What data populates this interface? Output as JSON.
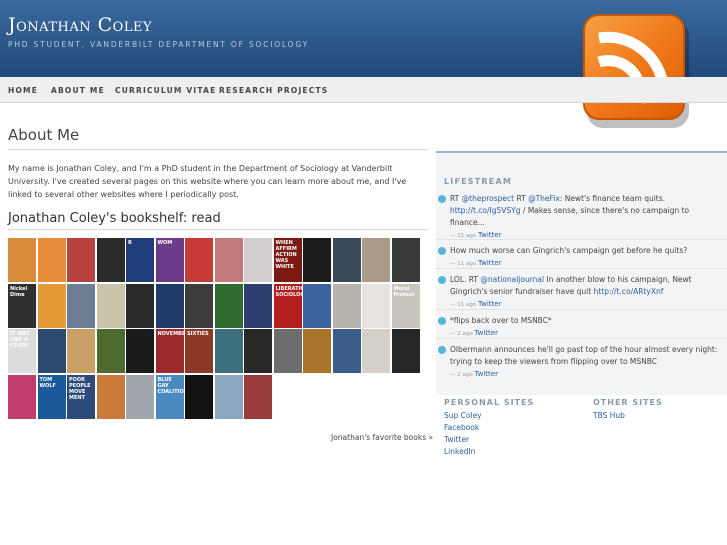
{
  "site": {
    "title": "Jonathan Coley",
    "tagline": "PhD student, Vanderbilt Department of Sociology"
  },
  "nav": [
    "Home",
    "About Me",
    "Curriculum Vitae",
    "Research Projects"
  ],
  "rss": {
    "icon": "rss-feed-icon",
    "color": "#f07a1a"
  },
  "about": {
    "heading": "About Me",
    "intro": "My name is Jonathan Coley, and I'm a PhD student in the Department of Sociology at Vanderbilt University. I've created several pages on this website where you can learn more about me, and I've linked to several other websites where I periodically post."
  },
  "bookshelf": {
    "heading": "Jonathan Coley's bookshelf: read",
    "favorite_link": "Jonathan's favorite books »",
    "books": [
      {
        "text": "",
        "color": "#d98a3a"
      },
      {
        "text": "",
        "color": "#e58b3a"
      },
      {
        "text": "",
        "color": "#b8423f"
      },
      {
        "text": "",
        "color": "#2b2b2b"
      },
      {
        "text": "R",
        "color": "#1f3d7a"
      },
      {
        "text": "WOM",
        "color": "#6b3a8a"
      },
      {
        "text": "",
        "color": "#c93b3b"
      },
      {
        "text": "",
        "color": "#c27b7a"
      },
      {
        "text": "",
        "color": "#d2ced0"
      },
      {
        "text": "WHEN AFFIRM ACTION WAS WHITE",
        "color": "#7a1a12"
      },
      {
        "text": "",
        "color": "#1d1d1d"
      },
      {
        "text": "",
        "color": "#3a4a5a"
      },
      {
        "text": "",
        "color": "#a99a8a"
      },
      {
        "text": "",
        "color": "#3a3a3a"
      },
      {
        "text": "Nickel Dime",
        "color": "#2f2f2f"
      },
      {
        "text": "",
        "color": "#e59a38"
      },
      {
        "text": "",
        "color": "#6b7e96"
      },
      {
        "text": "",
        "color": "#c9c3a8"
      },
      {
        "text": "",
        "color": "#2a2a2a"
      },
      {
        "text": "",
        "color": "#1e3b6a"
      },
      {
        "text": "",
        "color": "#3b3b3b"
      },
      {
        "text": "",
        "color": "#2f6a2f"
      },
      {
        "text": "",
        "color": "#2c3e70"
      },
      {
        "text": "LIBERATION SOCIOLOGY",
        "color": "#b21e1e"
      },
      {
        "text": "",
        "color": "#3c63a0"
      },
      {
        "text": "",
        "color": "#b8b3ad"
      },
      {
        "text": "",
        "color": "#e7e3de"
      },
      {
        "text": "Moral Protest",
        "color": "#c9c5bd"
      },
      {
        "text": "IT WAS LIKE A FEVER",
        "color": "#dcdcdc"
      },
      {
        "text": "",
        "color": "#2c4a6f"
      },
      {
        "text": "",
        "color": "#caa066"
      },
      {
        "text": "",
        "color": "#4d6b2c"
      },
      {
        "text": "",
        "color": "#1a1a1a"
      },
      {
        "text": "NOVEMBE",
        "color": "#9c2a2a"
      },
      {
        "text": "SIXTIES",
        "color": "#8c3a27"
      },
      {
        "text": "",
        "color": "#3e6f7e"
      },
      {
        "text": "",
        "color": "#282828"
      },
      {
        "text": "",
        "color": "#6d6d6d"
      },
      {
        "text": "",
        "color": "#a8742a"
      },
      {
        "text": "",
        "color": "#3a5d8a"
      },
      {
        "text": "",
        "color": "#d4d0c9"
      },
      {
        "text": "",
        "color": "#262626"
      },
      {
        "text": "",
        "color": "#c23c6e"
      },
      {
        "text": "TOM WOLF",
        "color": "#1a5a9a"
      },
      {
        "text": "POOR PEOPLE MOVE MENT",
        "color": "#2e4a7a"
      },
      {
        "text": "",
        "color": "#c97a3a"
      },
      {
        "text": "",
        "color": "#a1a6ac"
      },
      {
        "text": "BLUE GAY COALITION",
        "color": "#4a88c0"
      },
      {
        "text": "",
        "color": "#111111"
      },
      {
        "text": "",
        "color": "#8ba7c0"
      },
      {
        "text": "",
        "color": "#9a3a3a"
      }
    ]
  },
  "lifestream": {
    "heading": "Lifestream",
    "items": [
      {
        "text_pre": "RT ",
        "link1": "@theprospect",
        "text_mid": " RT ",
        "link2": "@TheFix",
        "text_post": ": Newt's finance team quits.",
        "link3": "http://t.co/Ig5VSYg",
        "text_end": " / Makes sense, since there's no campaign to finance...",
        "time": "— 11 ago",
        "via": "Twitter"
      },
      {
        "text": "How much worse can Gingrich's campaign get before he quits?",
        "time": "— 11 ago",
        "via": "Twitter"
      },
      {
        "text_pre": "LOL. RT ",
        "link1": "@nationaljournal",
        "text_mid": " In another blow to his campaign, Newt Gingrich's senior fundraiser have quit ",
        "link2": "http://t.co/ARtyXnf",
        "time": "— 11 ago",
        "via": "Twitter"
      },
      {
        "text": "*flips back over to MSNBC*",
        "time": "— 2 ago",
        "via": "Twitter"
      },
      {
        "text": "Olbermann announces he'll go past top of the hour almost every night: trying to keep the viewers from flipping over to MSNBC",
        "time": "— 2 ago",
        "via": "Twitter"
      }
    ]
  },
  "personal_sites": {
    "heading": "Personal Sites",
    "links": [
      "Sup Coley",
      "Facebook",
      "Twitter",
      "LinkedIn"
    ]
  },
  "other_sites": {
    "heading": "Other Sites",
    "links": [
      "TBS Hub"
    ]
  }
}
